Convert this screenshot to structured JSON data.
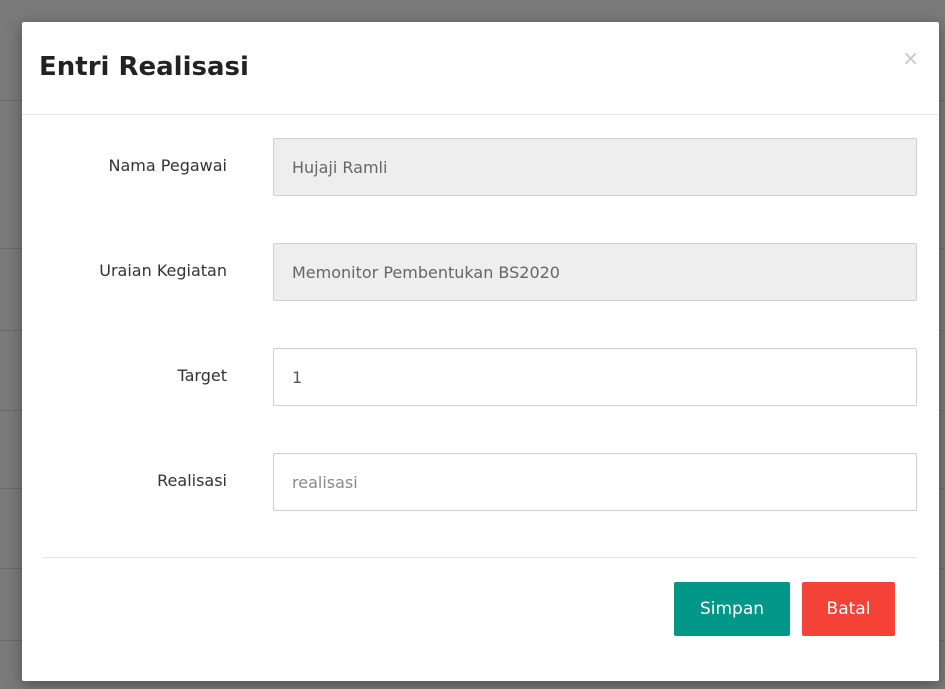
{
  "modal": {
    "title": "Entri Realisasi",
    "close_label": "×"
  },
  "form": {
    "nama_pegawai": {
      "label": "Nama Pegawai",
      "value": "Hujaji Ramli"
    },
    "uraian_kegiatan": {
      "label": "Uraian Kegiatan",
      "value": "Memonitor Pembentukan BS2020"
    },
    "target": {
      "label": "Target",
      "value": "1"
    },
    "realisasi": {
      "label": "Realisasi",
      "value": "",
      "placeholder": "realisasi"
    }
  },
  "buttons": {
    "save_label": "Simpan",
    "cancel_label": "Batal"
  },
  "colors": {
    "save": "#009688",
    "cancel": "#f44336",
    "backdrop": "#7a7a7a"
  }
}
